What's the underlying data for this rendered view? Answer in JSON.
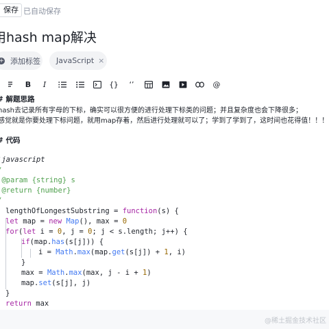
{
  "topbar": {
    "save_label": "保存",
    "auto_save": "已自动保存"
  },
  "title": "用hash map解决",
  "tags": {
    "add_label": "添加标签",
    "js_label": "JavaScript",
    "remove_glyph": "×"
  },
  "toolbar": {
    "bold": "B",
    "italic": "I",
    "inline_code": "{}",
    "quote": "‘’",
    "at": "@"
  },
  "content": {
    "h1": "解题思路",
    "p1": "hash去记录所有字母的下标，确实可以很方便的进行处理下标类的问题；并且复杂度也会下降很多；",
    "p2": "感觉就是你要处理下标问题，就用map存着，然后进行处理就可以了；学到了学到了，这时间也花得值！！！",
    "h2": "代码"
  },
  "code": {
    "lang": "javascript",
    "param": "@param {string} s",
    "ret": "@return {number}",
    "l1a": "lengthOfLongestSubstring",
    "l1b": " = ",
    "l1c": "function",
    "l1d": "(s) {",
    "l2a": "let",
    "l2b": " map = ",
    "l2c": "new",
    "l2d": " ",
    "l2e": "Map",
    "l2f": "(), max = ",
    "l2g": "0",
    "l3a": "for",
    "l3b": "(",
    "l3c": "let",
    "l3d": " i = ",
    "l3e": "0",
    "l3f": ", j = ",
    "l3g": "0",
    "l3h": "; j < s.length; j++) {",
    "l4a": "if",
    "l4b": "(map.",
    "l4c": "has",
    "l4d": "(s[j])) {",
    "l5a": "i = ",
    "l5b": "Math",
    "l5c": ".",
    "l5d": "max",
    "l5e": "(map.",
    "l5f": "get",
    "l5g": "(s[j]) + ",
    "l5h": "1",
    "l5i": ", i)",
    "l6": "}",
    "l7a": "max = ",
    "l7b": "Math",
    "l7c": ".",
    "l7d": "max",
    "l7e": "(max, j - i + ",
    "l7f": "1",
    "l7g": ")",
    "l8a": "map.",
    "l8b": "set",
    "l8c": "(s[j], j)",
    "l9": "}",
    "l10a": "return",
    "l10b": " max"
  },
  "footer": {
    "watermark": "@稀土掘金技术社区"
  }
}
